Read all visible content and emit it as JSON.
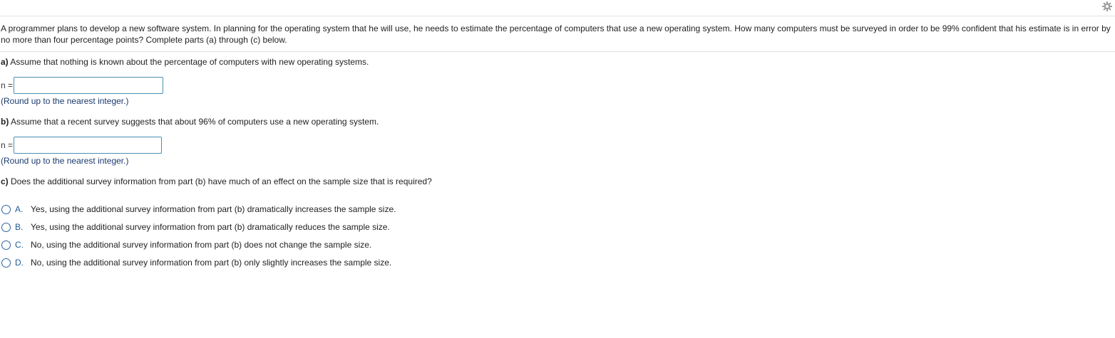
{
  "question": {
    "text": "A programmer plans to develop a new software system. In planning for the operating system that he will use, he needs to estimate the percentage of computers that use a new operating system. How many computers must be surveyed in order to be 99% confident that his estimate is in error by no more than four percentage points? Complete parts (a) through (c) below."
  },
  "part_a": {
    "label": "a)",
    "prompt": " Assume that nothing is known about the percentage of computers with new operating systems.",
    "n_label": "n =",
    "input_value": "",
    "hint": "(Round up to the nearest integer.)"
  },
  "part_b": {
    "label": "b)",
    "prompt": " Assume that a recent survey suggests that about 96% of computers use a new operating system.",
    "n_label": "n =",
    "input_value": "",
    "hint": "(Round up to the nearest integer.)"
  },
  "part_c": {
    "label": "c)",
    "prompt": " Does the additional survey information from part (b) have much of an effect on the sample size that is required?",
    "choices": [
      {
        "letter": "A.",
        "text": "Yes, using the additional survey information from part (b) dramatically increases the sample size."
      },
      {
        "letter": "B.",
        "text": "Yes, using the additional survey information from part (b) dramatically reduces the sample size."
      },
      {
        "letter": "C.",
        "text": "No, using the additional survey information from part (b) does not change the sample size."
      },
      {
        "letter": "D.",
        "text": "No, using the additional survey information from part (b) only slightly increases the sample size."
      }
    ]
  },
  "icons": {
    "top_right": "gear-icon"
  },
  "colors": {
    "input_border": "#4d8fb5",
    "radio_border": "#2a63a4",
    "choice_letter": "#1f5a96",
    "hint_text": "#1a3a6e"
  }
}
